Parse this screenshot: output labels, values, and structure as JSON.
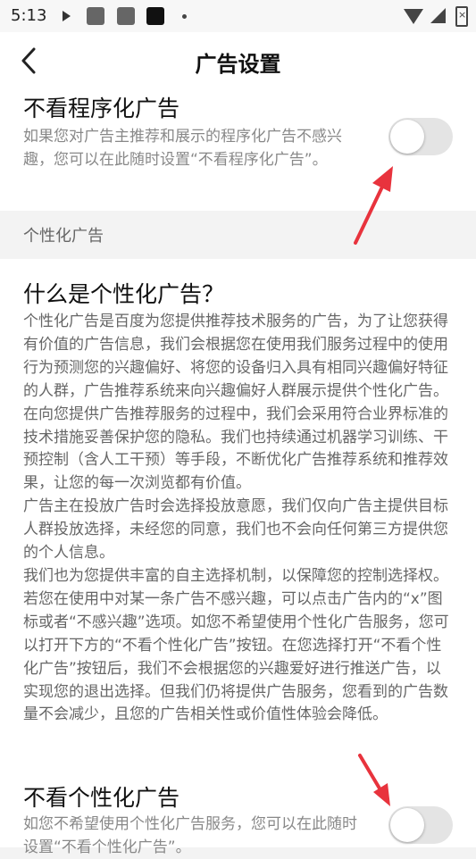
{
  "status_bar": {
    "time": "5:13",
    "icons": [
      "play-icon",
      "app-icon",
      "app-icon",
      "app-icon",
      "dot-icon",
      "wifi-icon",
      "signal-icon",
      "battery-icon"
    ]
  },
  "header": {
    "title": "广告设置",
    "back_icon": "back-arrow-icon"
  },
  "programmatic": {
    "title": "不看程序化广告",
    "description": "如果您对广告主推荐和展示的程序化广告不感兴趣，您可以在此随时设置“不看程序化广告”。",
    "toggle_on": false
  },
  "section_label": "个性化广告",
  "personalized_info": {
    "question": "什么是个性化广告？",
    "paragraphs": [
      "个性化广告是百度为您提供推荐技术服务的广告，为了让您获得有价值的广告信息，我们会根据您在使用我们服务过程中的使用行为预测您的兴趣偏好、将您的设备归入具有相同兴趣偏好特征的人群，广告推荐系统来向兴趣偏好人群展示提供个性化广告。在向您提供广告推荐服务的过程中，我们会采用符合业界标准的技术措施妥善保护您的隐私。我们也持续通过机器学习训练、干预控制（含人工干预）等手段，不断优化广告推荐系统和推荐效果，让您的每一次浏览都有价值。",
      "广告主在投放广告时会选择投放意愿，我们仅向广告主提供目标人群投放选择，未经您的同意，我们也不会向任何第三方提供您的个人信息。",
      "我们也为您提供丰富的自主选择机制，以保障您的控制选择权。若您在使用中对某一条广告不感兴趣，可以点击广告内的“x”图标或者“不感兴趣”选项。如您不希望使用个性化广告服务，您可以打开下方的“不看个性化广告”按钮。在您选择打开“不看个性化广告”按钮后，我们不会根据您的兴趣爱好进行推送广告，以实现您的退出选择。但我们仍将提供广告服务，您看到的广告数量不会减少，且您的广告相关性或价值性体验会降低。"
    ]
  },
  "personalized": {
    "title": "不看个性化广告",
    "description": "如您不希望使用个性化广告服务，您可以在此随时设置“不看个性化广告”。",
    "toggle_on": false
  },
  "colors": {
    "annotation_arrow": "#e8333d",
    "toggle_off": "#e4e4e4"
  }
}
